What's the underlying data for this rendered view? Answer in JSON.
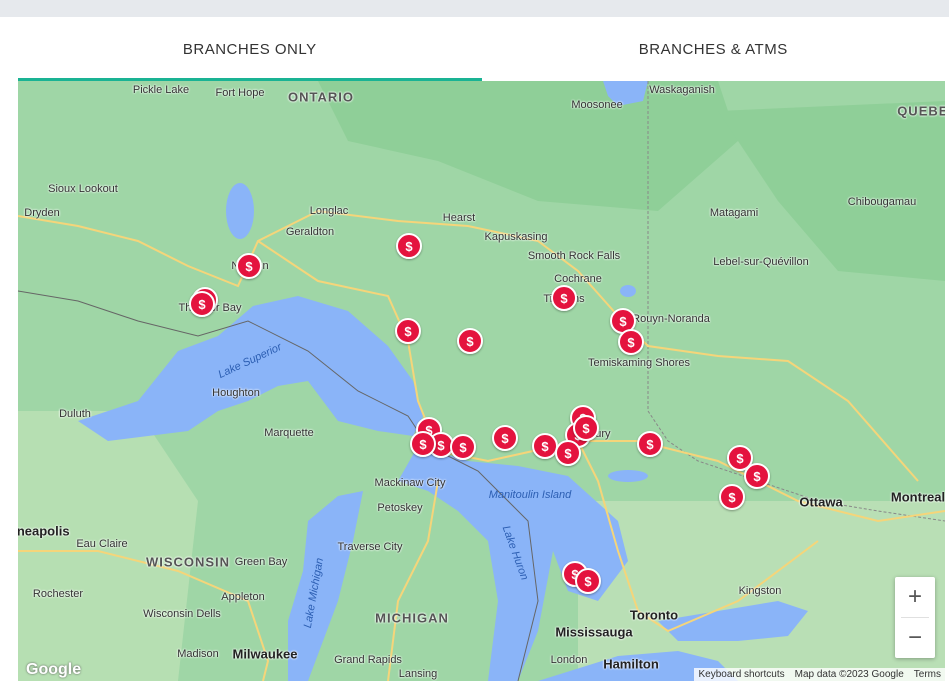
{
  "tabs": [
    {
      "label": "BRANCHES ONLY",
      "active": true
    },
    {
      "label": "BRANCHES & ATMS",
      "active": false
    }
  ],
  "colors": {
    "accent": "#1ab394",
    "marker": "#e4133e",
    "water": "#8ab4f8",
    "land": "#9fd6a6"
  },
  "map": {
    "region_labels": [
      "ONTARIO",
      "QUEBEC",
      "WISCONSIN",
      "MICHIGAN"
    ],
    "place_labels": [
      "Pickle Lake",
      "Fort Hope",
      "Moosonee",
      "Waskaganish",
      "Sioux Lookout",
      "Dryden",
      "Longlac",
      "Geraldton",
      "Hearst",
      "Kapuskasing",
      "Smooth Rock Falls",
      "Cochrane",
      "Matagami",
      "Chibougamau",
      "Lebel-sur-Quévillon",
      "Nipigon",
      "Thunder Bay",
      "Timmins",
      "Rouyn-Noranda",
      "Temiskaming Shores",
      "Houghton",
      "Duluth",
      "Marquette",
      "Sudbury",
      "Mackinaw City",
      "Petoskey",
      "Manitoulin Island",
      "Traverse City",
      "Eau Claire",
      "Green Bay",
      "Appleton",
      "Wisconsin Dells",
      "Rochester",
      "Madison",
      "Grand Rapids",
      "Lansing",
      "London",
      "Kingston",
      "Ottawa",
      "Montreal",
      "Toronto",
      "Mississauga",
      "Hamilton",
      "Milwaukee",
      "Minneapolis"
    ],
    "water_labels": [
      "Lake Superior",
      "Lake Michigan",
      "Lake Huron"
    ],
    "marker_symbol": "$",
    "marker_count": 25,
    "zoom_in": "+",
    "zoom_out": "−",
    "logo": "Google",
    "attribution": [
      "Keyboard shortcuts",
      "Map data ©2023 Google",
      "Terms"
    ]
  }
}
